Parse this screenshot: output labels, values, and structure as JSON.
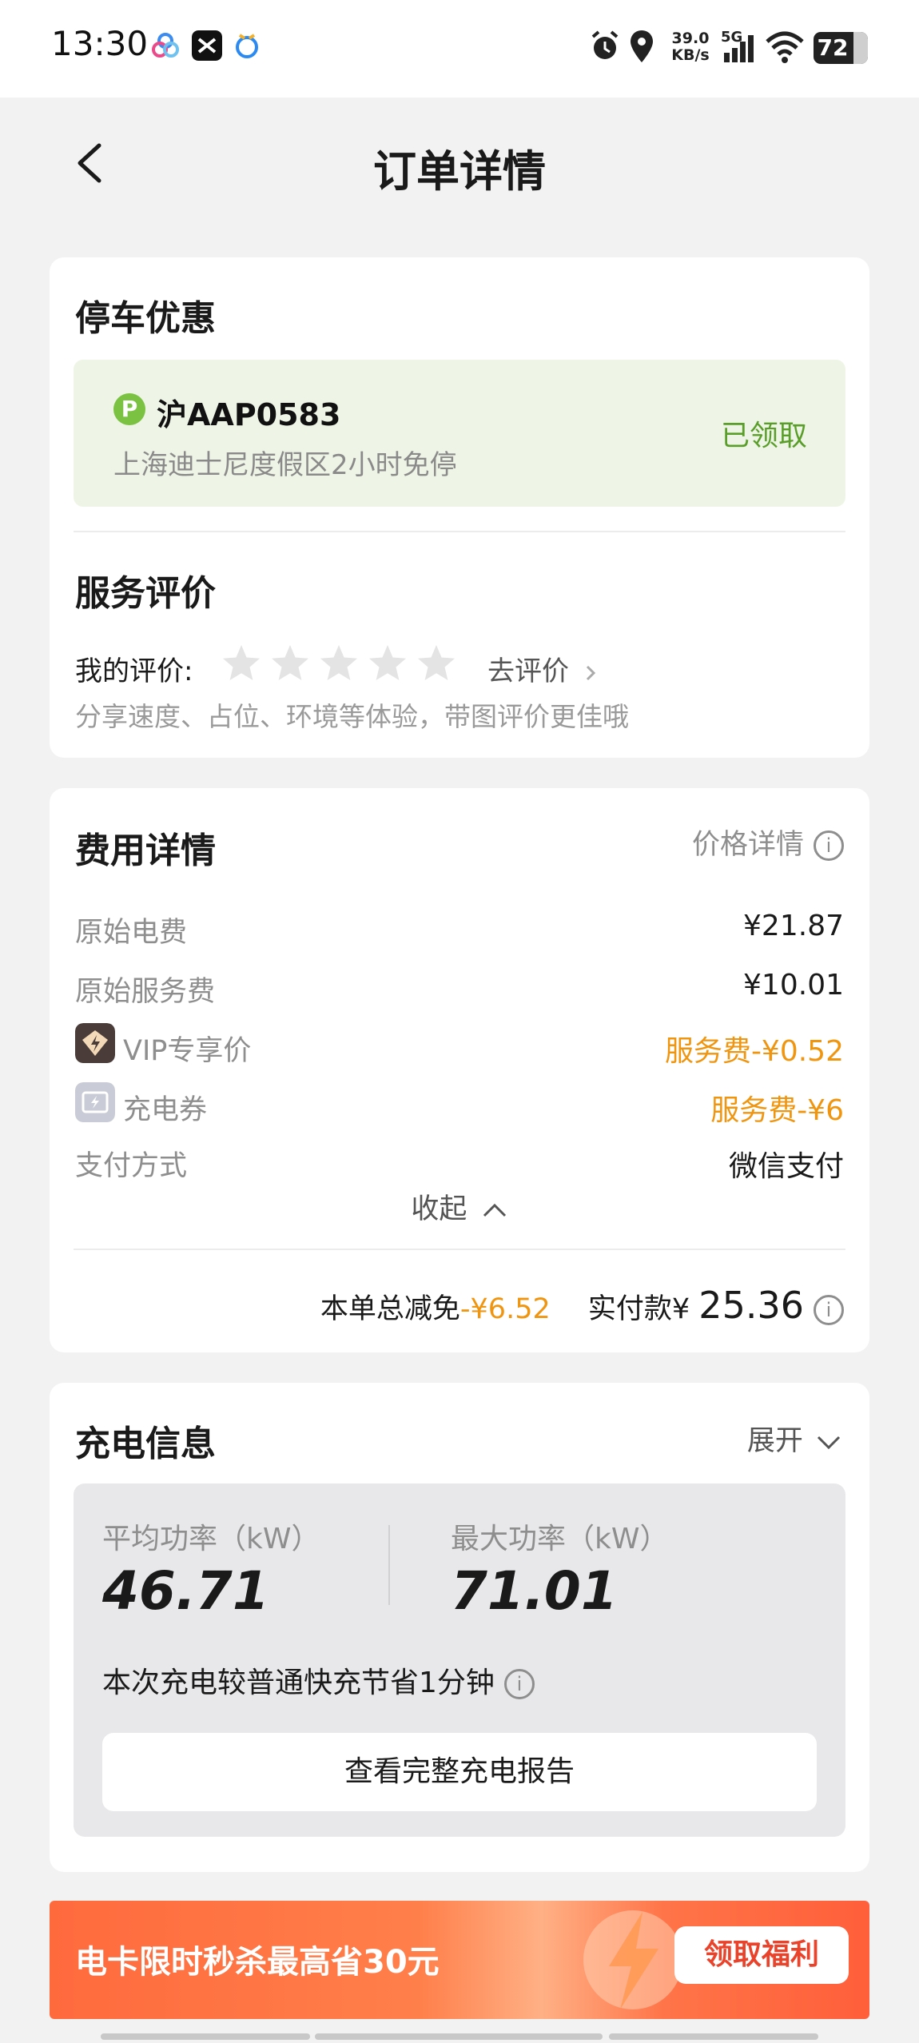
{
  "status_bar": {
    "time": "13:30",
    "net_speed_top": "39.0",
    "net_speed_bottom": "KB/s",
    "network": "5G",
    "battery": "72"
  },
  "nav": {
    "title": "订单详情"
  },
  "parking": {
    "section_title": "停车优惠",
    "badge": "P",
    "plate": "沪AAP0583",
    "description": "上海迪士尼度假区2小时免停",
    "status": "已领取"
  },
  "rating": {
    "section_title": "服务评价",
    "my_rating_label": "我的评价:",
    "stars_filled": 0,
    "stars_total": 5,
    "go_rate": "去评价",
    "hint": "分享速度、占位、环境等体验，带图评价更佳哦"
  },
  "fees": {
    "section_title": "费用详情",
    "price_detail": "价格详情",
    "rows": [
      {
        "label": "原始电费",
        "value": "¥21.87"
      },
      {
        "label": "原始服务费",
        "value": "¥10.01"
      },
      {
        "label": "VIP专享价",
        "value": "服务费-¥0.52"
      },
      {
        "label": "充电券",
        "value": "服务费-¥6"
      },
      {
        "label": "支付方式",
        "value": "微信支付"
      }
    ],
    "collapse": "收起",
    "total_discount_label": "本单总减免",
    "total_discount_value": "-¥6.52",
    "paid_label": "实付款¥",
    "paid_value": "25.36"
  },
  "charging": {
    "section_title": "充电信息",
    "expand": "展开",
    "avg_power_label": "平均功率（kW）",
    "avg_power_value": "46.71",
    "max_power_label": "最大功率（kW）",
    "max_power_value": "71.01",
    "saving_note": "本次充电较普通快充节省1分钟",
    "report_button": "查看完整充电报告"
  },
  "banner": {
    "text": "电卡限时秒杀最高省30元",
    "button": "领取福利"
  },
  "colors": {
    "accent_orange": "#f0950f",
    "claimed_green": "#5a9e2a",
    "park_bg": "#eef5e6",
    "banner_start": "#ff6a3d"
  }
}
